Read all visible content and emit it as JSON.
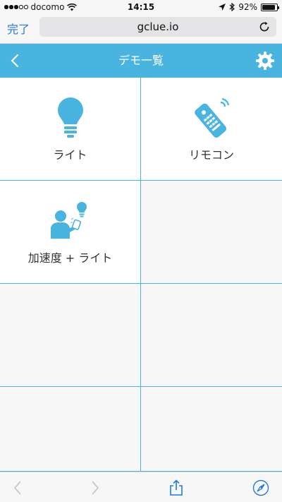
{
  "status": {
    "carrier": "docomo",
    "time": "14:15",
    "battery": "92%",
    "battery_level": 0.92,
    "signal_bars_on": 3,
    "signal_bars_total": 5
  },
  "browser": {
    "done_label": "完了",
    "url": "gclue.io"
  },
  "header": {
    "title": "デモ一覧"
  },
  "tiles": [
    {
      "label": "ライト",
      "icon": "lightbulb-icon"
    },
    {
      "label": "リモコン",
      "icon": "remote-control-icon"
    },
    {
      "label": "加速度 + ライト",
      "icon": "person-accelerometer-light-icon"
    }
  ],
  "colors": {
    "accent": "#4ab4e0",
    "link": "#1f7ae0"
  }
}
